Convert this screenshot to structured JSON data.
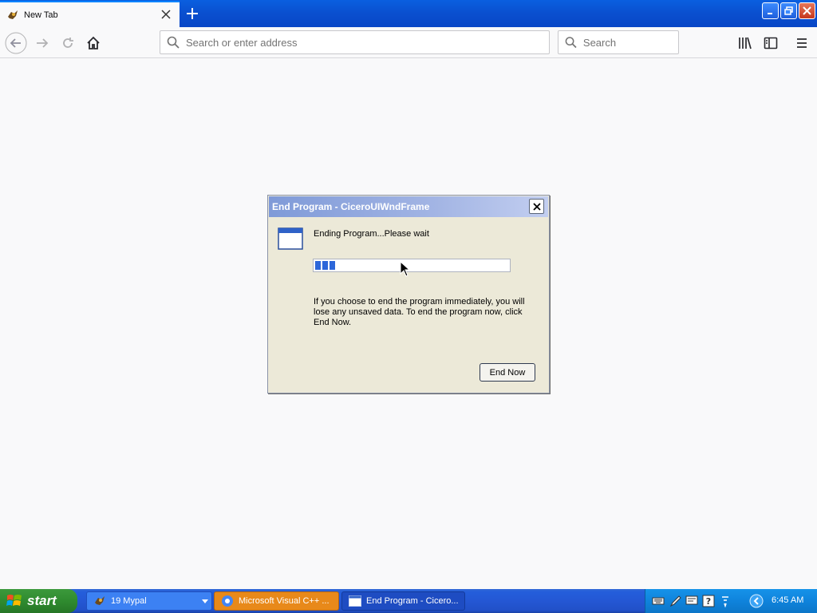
{
  "browser": {
    "tab_title": "New Tab",
    "url_placeholder": "Search or enter address",
    "search_placeholder": "Search"
  },
  "dialog": {
    "title": "End Program - CiceroUIWndFrame",
    "message": "Ending Program...Please wait",
    "progress_fraction": 0.11,
    "warning": "If you choose to end the program immediately, you will lose any unsaved data. To end the program now, click End Now.",
    "end_now_label": "End Now"
  },
  "taskbar": {
    "start_label": "start",
    "tasks": [
      {
        "label": "19 Mypal"
      },
      {
        "label": "Microsoft Visual C++ ..."
      },
      {
        "label": "End Program - Cicero..."
      }
    ],
    "clock": "6:45 AM"
  },
  "colors": {
    "xp_blue": "#245edb",
    "start_green": "#2f8b2f",
    "tray_blue": "#0f83dc",
    "progress_blue": "#2d67d9"
  }
}
